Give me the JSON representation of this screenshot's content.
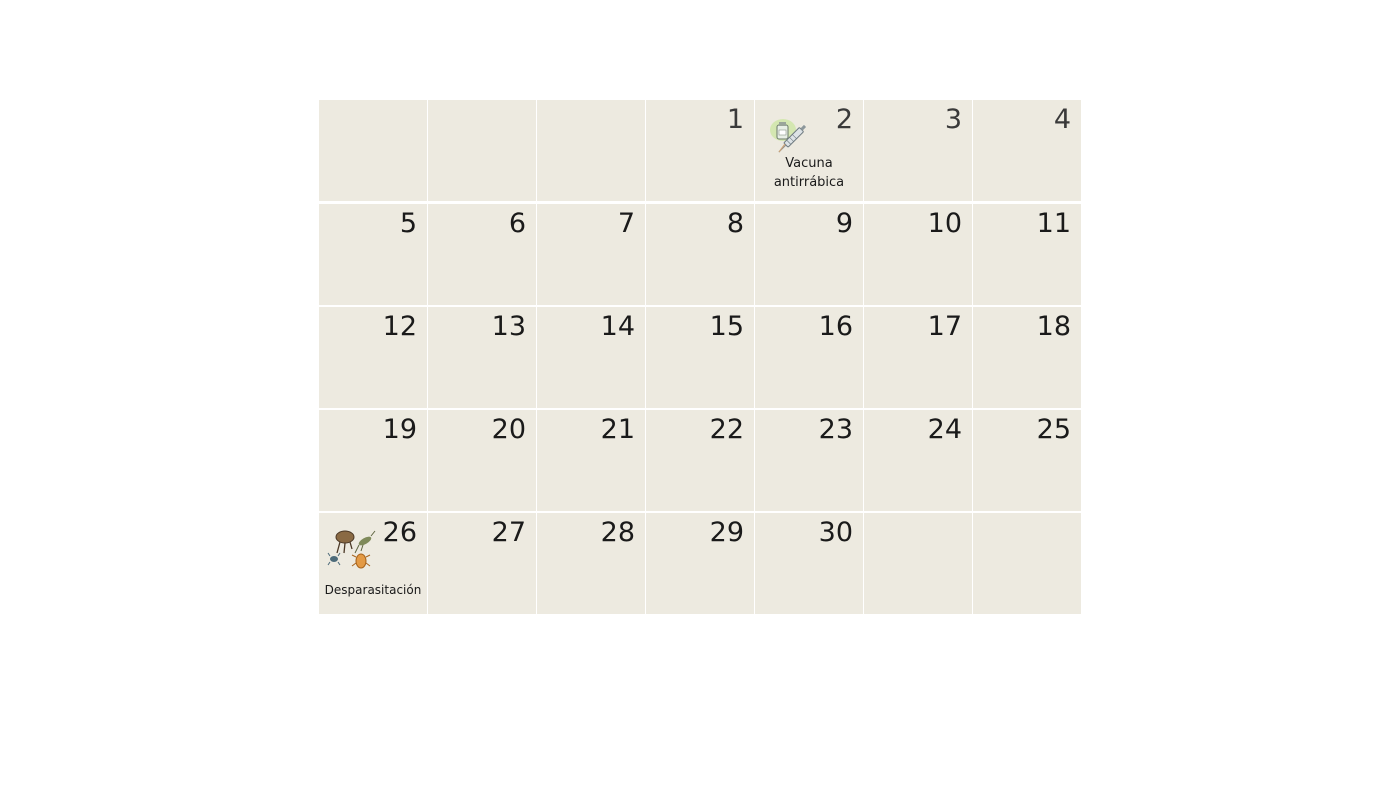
{
  "calendar": {
    "weeks": [
      [
        "",
        "",
        "",
        "1",
        "2",
        "3",
        "4"
      ],
      [
        "5",
        "6",
        "7",
        "8",
        "9",
        "10",
        "11"
      ],
      [
        "12",
        "13",
        "14",
        "15",
        "16",
        "17",
        "18"
      ],
      [
        "19",
        "20",
        "21",
        "22",
        "23",
        "24",
        "25"
      ],
      [
        "26",
        "27",
        "28",
        "29",
        "30",
        "",
        ""
      ]
    ],
    "events": {
      "rabies_vaccine": {
        "day": "2",
        "label_line1": "Vacuna",
        "label_line2": "antirrábica",
        "icon": "syringe-vaccine-icon"
      },
      "deworming": {
        "day": "26",
        "label": "Desparasitación",
        "icon": "parasites-icon"
      }
    }
  },
  "colors": {
    "cell_background": "#edeae0",
    "page_background": "#ffffff",
    "text": "#1a1a1a"
  }
}
